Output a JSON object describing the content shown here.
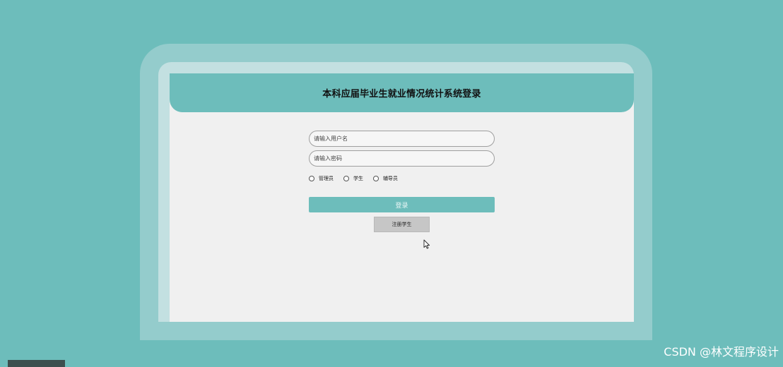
{
  "page": {
    "title": "本科应届毕业生就业情况统计系统登录"
  },
  "form": {
    "username_placeholder": "请输入用户名",
    "password_placeholder": "请输入密码",
    "roles": [
      {
        "label": "管理员"
      },
      {
        "label": "学生"
      },
      {
        "label": "辅导员"
      }
    ],
    "login_label": "登录",
    "register_label": "注册学生"
  },
  "watermark": "CSDN @林文程序设计",
  "colors": {
    "background": "#6dbdbb",
    "accent": "#6dbdbb",
    "panel": "#f0f0f0",
    "frame_outer": "#94cccc",
    "frame_inner": "#c3e0e1"
  },
  "icons": {
    "cursor": "mouse-pointer-icon"
  }
}
